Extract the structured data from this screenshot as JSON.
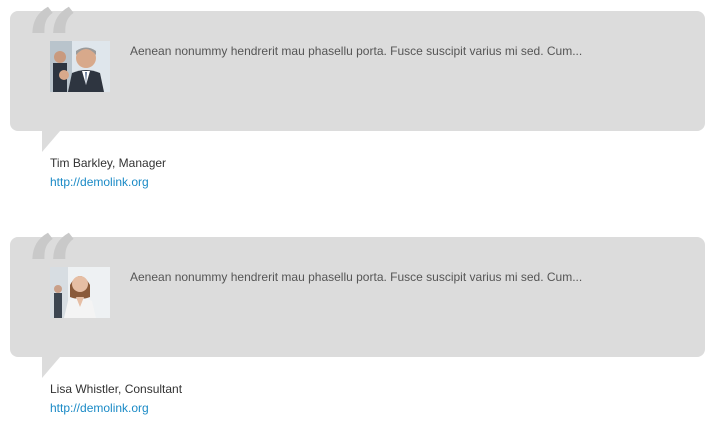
{
  "testimonials": [
    {
      "quote": "Aenean nonummy hendrerit mau phasellu porta. Fusce suscipit varius mi sed. Cum...",
      "author": "Tim Barkley, Manager",
      "link": "http://demolink.org",
      "avatar": "businessman-photo"
    },
    {
      "quote": "Aenean nonummy hendrerit mau phasellu porta. Fusce suscipit varius mi sed. Cum...",
      "author": "Lisa Whistler, Consultant",
      "link": "http://demolink.org",
      "avatar": "businesswoman-photo"
    }
  ],
  "colors": {
    "bubble": "#dcdcdc",
    "quote_mark": "#c9c9c9",
    "text": "#555555",
    "link": "#1a8ac6"
  }
}
